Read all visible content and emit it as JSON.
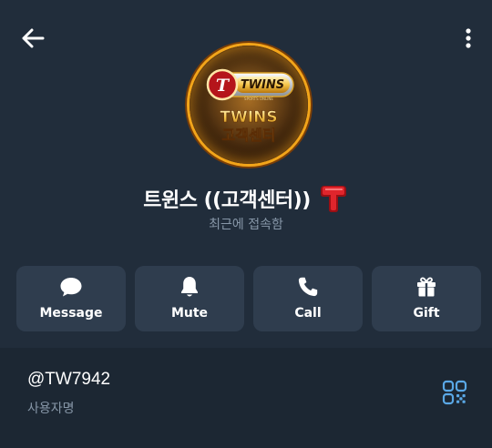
{
  "header": {
    "back_icon": "arrow-left-icon",
    "more_icon": "more-vertical-icon"
  },
  "avatar": {
    "badge_text": "TWINS",
    "title_line1": "TWINS",
    "title_line2": "고객센터",
    "sub_text": "SPORTS ONLINE"
  },
  "profile": {
    "name": "트윈스 ((고객센터))",
    "badge_letter": "T",
    "status": "최근에 접속함"
  },
  "actions": [
    {
      "label": "Message",
      "icon": "message-icon"
    },
    {
      "label": "Mute",
      "icon": "bell-icon"
    },
    {
      "label": "Call",
      "icon": "phone-icon"
    },
    {
      "label": "Gift",
      "icon": "gift-icon"
    }
  ],
  "info": {
    "username": "@TW7942",
    "username_caption": "사용자명",
    "qr_icon": "qr-code-icon"
  },
  "colors": {
    "background": "#212d3b",
    "card": "#2f3d4e",
    "muted_text": "#8797a8",
    "accent_blue": "#5aa8e6",
    "badge_red": "#d61f26",
    "gold": "#f2a51a"
  }
}
